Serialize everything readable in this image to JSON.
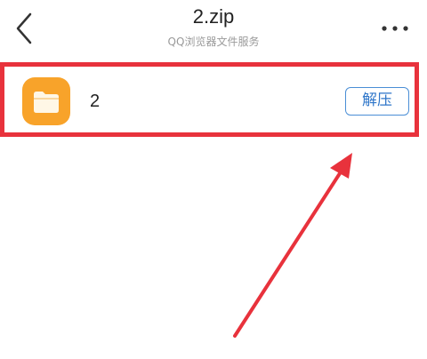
{
  "header": {
    "title": "2.zip",
    "subtitle": "QQ浏览器文件服务",
    "back_icon": "chevron-left-icon",
    "more_icon": "more-horizontal-icon"
  },
  "file_row": {
    "icon": "folder-icon",
    "name": "2",
    "extract_label": "解压"
  },
  "colors": {
    "highlight": "#e8323c",
    "folder": "#f8a32a",
    "button_accent": "#2f76c9"
  }
}
